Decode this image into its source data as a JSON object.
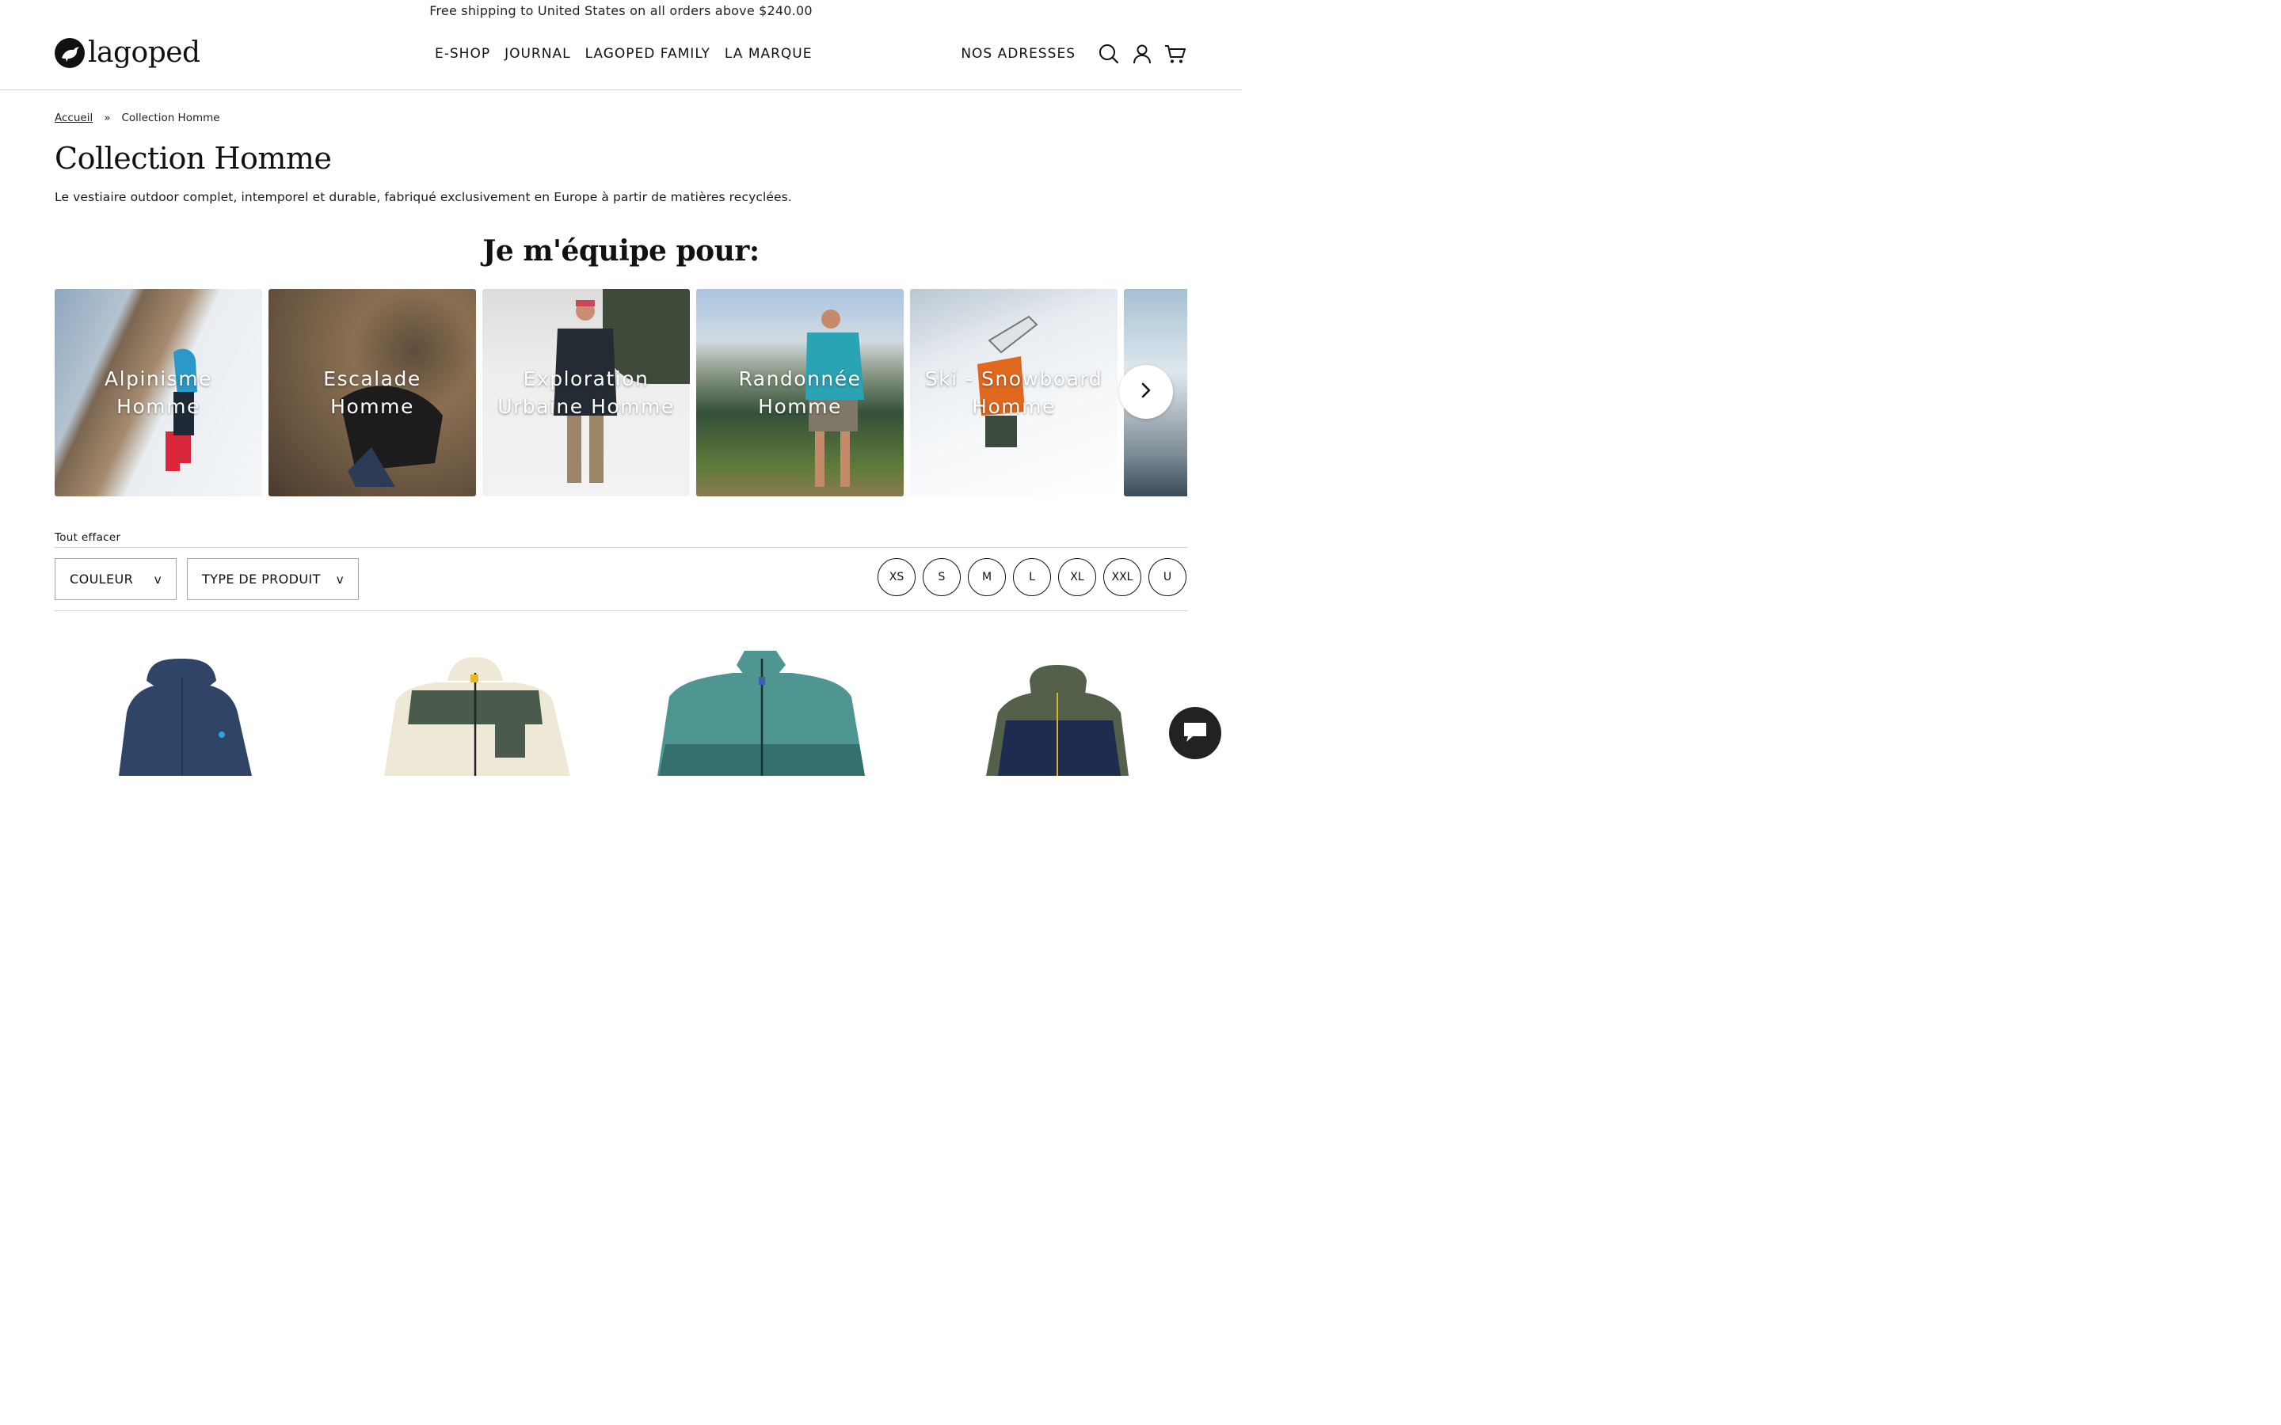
{
  "announcement": "Free shipping to United States on all orders above $240.00",
  "header": {
    "logo_text": "lagoped",
    "nav": [
      "E-SHOP",
      "JOURNAL",
      "LAGOPED FAMILY",
      "LA MARQUE"
    ],
    "addresses_label": "NOS ADRESSES",
    "icons": [
      "search-icon",
      "account-icon",
      "cart-icon"
    ]
  },
  "breadcrumb": {
    "home": "Accueil",
    "separator": "»",
    "current": "Collection Homme"
  },
  "page": {
    "title": "Collection Homme",
    "description": "Le vestiaire outdoor complet, intemporel et durable, fabriqué exclusivement en Europe à partir de matières recyclées."
  },
  "equip": {
    "title": "Je m'équipe pour:",
    "cards": [
      {
        "label": "Alpinisme Homme"
      },
      {
        "label": "Escalade Homme"
      },
      {
        "label": "Exploration Urbaine Homme"
      },
      {
        "label": "Randonnée Homme"
      },
      {
        "label": "Ski - Snowboard Homme"
      }
    ],
    "next_icon": "chevron-right-icon"
  },
  "filters": {
    "clear_all": "Tout effacer",
    "color_label": "COULEUR",
    "type_label": "TYPE DE PRODUIT",
    "chevron": "v",
    "sizes": [
      "XS",
      "S",
      "M",
      "L",
      "XL",
      "XXL",
      "U"
    ]
  },
  "colors": {
    "accent": "#111111",
    "border": "#a8a8a8",
    "product_navy": "#2f4466",
    "product_cream": "#eee9d6",
    "product_green": "#4a5a4c",
    "product_teal": "#4f9592",
    "product_olive": "#55604a"
  },
  "chat_icon": "chat-bubble-icon"
}
